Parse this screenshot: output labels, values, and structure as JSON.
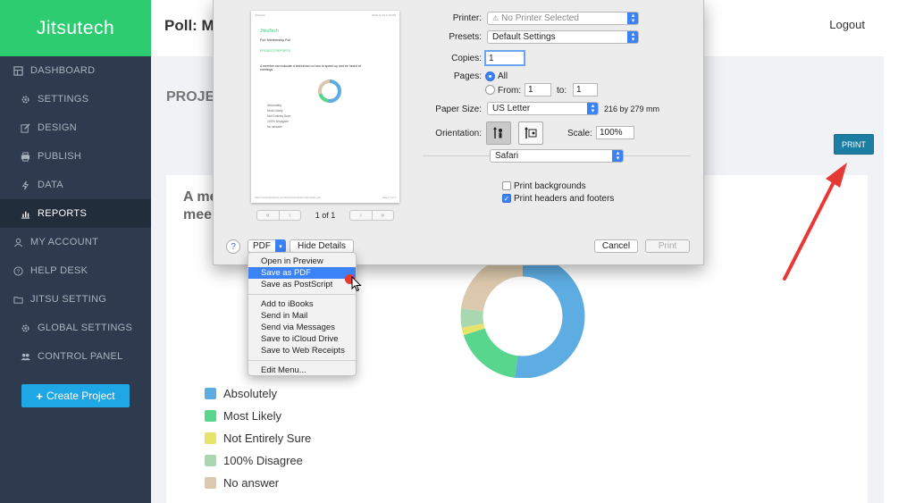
{
  "brand": "Jitsutech",
  "header": {
    "poll_title": "Poll: Me",
    "logout": "Logout"
  },
  "sidebar": {
    "items": [
      {
        "label": "DASHBOARD",
        "icon": "dashboard-icon"
      },
      {
        "label": "SETTINGS",
        "icon": "gear-icon"
      },
      {
        "label": "DESIGN",
        "icon": "edit-icon"
      },
      {
        "label": "PUBLISH",
        "icon": "print-icon"
      },
      {
        "label": "DATA",
        "icon": "lightning-icon"
      },
      {
        "label": "REPORTS",
        "icon": "bar-chart-icon",
        "active": true
      },
      {
        "label": "MY ACCOUNT",
        "icon": "user-icon"
      },
      {
        "label": "HELP DESK",
        "icon": "help-icon"
      },
      {
        "label": "JITSU SETTING",
        "icon": "folder-icon"
      },
      {
        "label": "GLOBAL SETTINGS",
        "icon": "gear-icon"
      },
      {
        "label": "CONTROL PANEL",
        "icon": "users-icon"
      }
    ],
    "create_button": "Create Project"
  },
  "main": {
    "section_title": "PROJEC",
    "print_button": "PRINT",
    "question_line1": "A me",
    "question_line2": "mee"
  },
  "chart_data": {
    "type": "pie",
    "categories": [
      "Absolutely",
      "Most Likely",
      "Not Entirely Sure",
      "100% Disagree",
      "No answer"
    ],
    "values": [
      52,
      18,
      2,
      5,
      23
    ],
    "colors": [
      "#5dade2",
      "#58d68d",
      "#e8e36a",
      "#a9d8b0",
      "#dcc9ad"
    ],
    "donut": true,
    "legend": "bottom-left"
  },
  "print_dialog": {
    "preview": {
      "header_left": "Jitsutech",
      "header_right": "2016-11-10 1:23 PM",
      "logo": "JitsuTech",
      "poll_line": "Poll: Membership Poll",
      "section": "PROJECT REPORTS",
      "question": "A member can educate a technician on how to speed up and be heard at meetings",
      "legend": [
        "Absolutely",
        "Most Likely",
        "Not Entirely Sure",
        "100% Disagree",
        "No answer"
      ],
      "footer_left": "https://www.jitsutech.com/reports/polls/membership-poll",
      "footer_right": "Page 1 of 1",
      "page_indicator": "1 of 1"
    },
    "printer_label": "Printer:",
    "printer_value": "No Printer Selected",
    "presets_label": "Presets:",
    "presets_value": "Default Settings",
    "copies_label": "Copies:",
    "copies_value": "1",
    "pages_label": "Pages:",
    "pages_all": "All",
    "pages_from": "From:",
    "pages_from_value": "1",
    "pages_to": "to:",
    "pages_to_value": "1",
    "paper_size_label": "Paper Size:",
    "paper_size_value": "US Letter",
    "paper_size_dims": "216 by 279 mm",
    "orientation_label": "Orientation:",
    "scale_label": "Scale:",
    "scale_value": "100%",
    "app_section": "Safari",
    "print_backgrounds": "Print backgrounds",
    "print_headers_footers": "Print headers and footers",
    "help": "?",
    "pdf_button": "PDF",
    "hide_details": "Hide Details",
    "cancel": "Cancel",
    "print": "Print"
  },
  "pdf_menu": {
    "group1": [
      "Open in Preview",
      "Save as PDF",
      "Save as PostScript"
    ],
    "group2": [
      "Add to iBooks",
      "Send in Mail",
      "Send via Messages",
      "Save to iCloud Drive",
      "Save to Web Receipts"
    ],
    "group3": [
      "Edit Menu..."
    ],
    "highlighted": "Save as PDF"
  },
  "colors": {
    "brand_green": "#2ecc71",
    "sidebar": "#2e3b4e",
    "accent_blue": "#1ea7e4",
    "print_button": "#1c7ea3",
    "arrow_red": "#e53935"
  }
}
